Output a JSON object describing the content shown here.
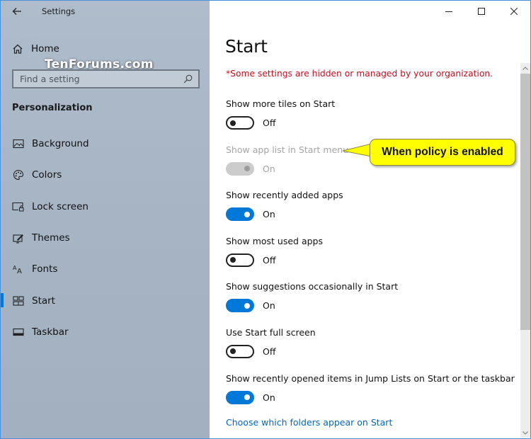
{
  "window": {
    "app_title": "Settings",
    "caption": {
      "minimize": "minimize-icon",
      "maximize": "maximize-icon",
      "close": "close-icon"
    }
  },
  "sidebar": {
    "back_icon": "back-arrow-icon",
    "home": {
      "label": "Home",
      "icon": "home-icon"
    },
    "watermark": "TenForums.com",
    "search": {
      "placeholder": "Find a setting",
      "value": "",
      "icon": "search-icon"
    },
    "section_title": "Personalization",
    "items": [
      {
        "label": "Background",
        "icon": "picture-icon",
        "active": false
      },
      {
        "label": "Colors",
        "icon": "palette-icon",
        "active": false
      },
      {
        "label": "Lock screen",
        "icon": "lock-screen-icon",
        "active": false
      },
      {
        "label": "Themes",
        "icon": "themes-icon",
        "active": false
      },
      {
        "label": "Fonts",
        "icon": "fonts-icon",
        "active": false
      },
      {
        "label": "Start",
        "icon": "start-icon",
        "active": true
      },
      {
        "label": "Taskbar",
        "icon": "taskbar-icon",
        "active": false
      }
    ]
  },
  "main": {
    "title": "Start",
    "policy_note": "*Some settings are hidden or managed by your organization.",
    "settings": [
      {
        "label": "Show more tiles on Start",
        "state": "Off",
        "on": false,
        "disabled": false
      },
      {
        "label": "Show app list in Start menu",
        "state": "On",
        "on": true,
        "disabled": true
      },
      {
        "label": "Show recently added apps",
        "state": "On",
        "on": true,
        "disabled": false
      },
      {
        "label": "Show most used apps",
        "state": "Off",
        "on": false,
        "disabled": false
      },
      {
        "label": "Show suggestions occasionally in Start",
        "state": "On",
        "on": true,
        "disabled": false
      },
      {
        "label": "Use Start full screen",
        "state": "Off",
        "on": false,
        "disabled": false
      },
      {
        "label": "Show recently opened items in Jump Lists on Start or the taskbar",
        "state": "On",
        "on": true,
        "disabled": false
      }
    ],
    "folders_link": "Choose which folders appear on Start"
  },
  "callout": {
    "text": "When policy is enabled"
  },
  "colors": {
    "accent": "#0078d7",
    "policy_red": "#c50f1f",
    "link": "#0067c0",
    "callout_fill": "#ffff00",
    "disabled_text": "#a5a5a5"
  }
}
